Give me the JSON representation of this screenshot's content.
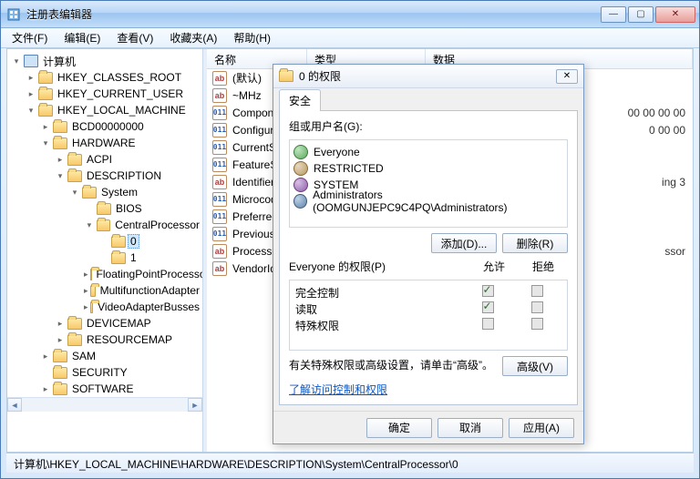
{
  "window": {
    "title": "注册表编辑器"
  },
  "menu": {
    "file": "文件(F)",
    "edit": "编辑(E)",
    "view": "查看(V)",
    "favorites": "收藏夹(A)",
    "help": "帮助(H)"
  },
  "tree": {
    "root": "计算机",
    "hkcr": "HKEY_CLASSES_ROOT",
    "hkcu": "HKEY_CURRENT_USER",
    "hklm": "HKEY_LOCAL_MACHINE",
    "bcd": "BCD00000000",
    "hardware": "HARDWARE",
    "acpi": "ACPI",
    "description": "DESCRIPTION",
    "system": "System",
    "bios": "BIOS",
    "centralproc": "CentralProcessor",
    "cp0": "0",
    "cp1": "1",
    "floating": "FloatingPointProcessor",
    "multifn": "MultifunctionAdapter",
    "videoadapter": "VideoAdapterBusses",
    "devicemap": "DEVICEMAP",
    "resourcemap": "RESOURCEMAP",
    "sam": "SAM",
    "security": "SECURITY",
    "software": "SOFTWARE"
  },
  "list": {
    "col_name": "名称",
    "col_type": "类型",
    "col_data": "数据",
    "rows": [
      {
        "icon": "ab",
        "name": "(默认)"
      },
      {
        "icon": "ab",
        "name": "~MHz"
      },
      {
        "icon": "bin",
        "name": "Component Information",
        "data": "00 00 00 00"
      },
      {
        "icon": "bin",
        "name": "Configuration Data",
        "data": "0 00 00"
      },
      {
        "icon": "bin",
        "name": "CurrentSpeedMHz"
      },
      {
        "icon": "bin",
        "name": "FeatureSet"
      },
      {
        "icon": "ab",
        "name": "Identifier",
        "data": "ing 3"
      },
      {
        "icon": "bin",
        "name": "MicrocodeRevision"
      },
      {
        "icon": "bin",
        "name": "PreferredProfile"
      },
      {
        "icon": "bin",
        "name": "PreviousUpdate"
      },
      {
        "icon": "ab",
        "name": "ProcessorNameString",
        "data": "ssor"
      },
      {
        "icon": "ab",
        "name": "VendorIdentifier"
      }
    ]
  },
  "dialog": {
    "title": "0 的权限",
    "tab": "安全",
    "group_label": "组或用户名(G):",
    "users": [
      {
        "cls": "ui-everyone",
        "name": "Everyone"
      },
      {
        "cls": "ui-restricted",
        "name": "RESTRICTED"
      },
      {
        "cls": "ui-system",
        "name": "SYSTEM"
      },
      {
        "cls": "ui-admin",
        "name": "Administrators (OOMGUNJEPC9C4PQ\\Administrators)"
      }
    ],
    "add": "添加(D)...",
    "remove": "删除(R)",
    "perm_for": "Everyone 的权限(P)",
    "allow": "允许",
    "deny": "拒绝",
    "perms": [
      {
        "name": "完全控制",
        "allow": "gray-checked",
        "deny": "gray"
      },
      {
        "name": "读取",
        "allow": "gray-checked",
        "deny": "gray"
      },
      {
        "name": "特殊权限",
        "allow": "gray",
        "deny": "gray"
      }
    ],
    "adv_text": "有关特殊权限或高级设置，请单击“高级”。",
    "advanced": "高级(V)",
    "link": "了解访问控制和权限",
    "ok": "确定",
    "cancel": "取消",
    "apply": "应用(A)"
  },
  "status": "计算机\\HKEY_LOCAL_MACHINE\\HARDWARE\\DESCRIPTION\\System\\CentralProcessor\\0"
}
